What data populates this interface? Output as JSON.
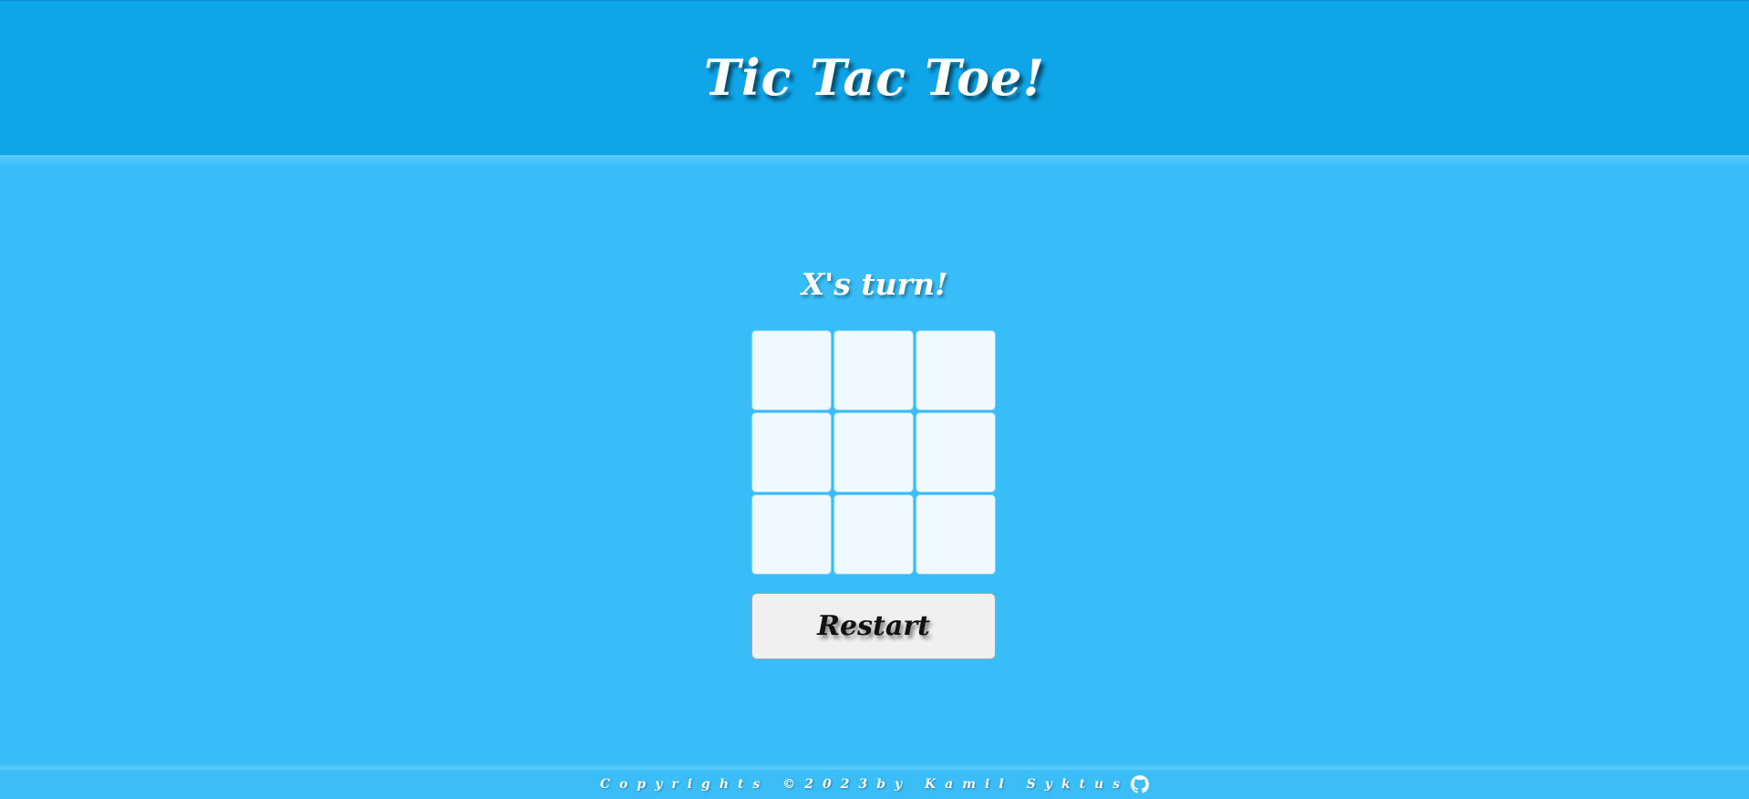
{
  "header": {
    "title": "Tic Tac Toe!"
  },
  "game": {
    "status": "X's turn!",
    "board": [
      [
        "",
        "",
        ""
      ],
      [
        "",
        "",
        ""
      ],
      [
        "",
        "",
        ""
      ]
    ],
    "restart_label": "Restart"
  },
  "footer": {
    "text": "Copyrights ©2023by Kamil Syktus",
    "icon": "github-icon"
  },
  "colors": {
    "header_bg": "#0ea5e9",
    "page_bg": "#38bdf8",
    "cell_bg": "#f0f9ff",
    "button_bg": "#f0f0f0"
  }
}
